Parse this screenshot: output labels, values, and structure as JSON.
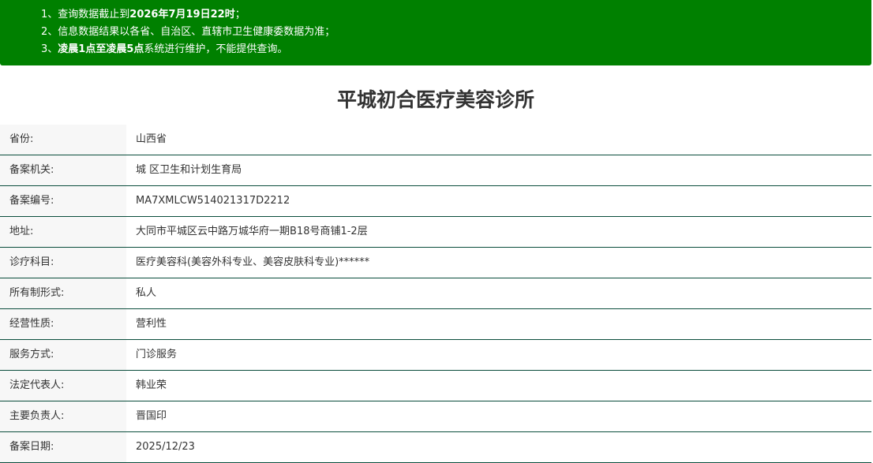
{
  "notice": {
    "line1_prefix": "1、查询数据截止到",
    "line1_bold": "2026年7月19日22时",
    "line1_suffix": "；",
    "line2": "2、信息数据结果以各省、自治区、直辖市卫生健康委数据为准；",
    "line3_prefix": "3、",
    "line3_bold": "凌晨1点至凌晨5点",
    "line3_suffix": "系统进行维护，不能提供查询。"
  },
  "title": "平城初合医疗美容诊所",
  "rows": [
    {
      "label": "省份:",
      "value": "山西省"
    },
    {
      "label": "备案机关:",
      "value": "城 区卫生和计划生育局"
    },
    {
      "label": "备案编号:",
      "value": "MA7XMLCW514021317D2212"
    },
    {
      "label": "地址:",
      "value": "大同市平城区云中路万城华府一期B18号商铺1-2层"
    },
    {
      "label": "诊疗科目:",
      "value": "医疗美容科(美容外科专业、美容皮肤科专业)******"
    },
    {
      "label": "所有制形式:",
      "value": "私人"
    },
    {
      "label": "经营性质:",
      "value": "营利性"
    },
    {
      "label": "服务方式:",
      "value": "门诊服务"
    },
    {
      "label": "法定代表人:",
      "value": "韩业荣"
    },
    {
      "label": "主要负责人:",
      "value": "晋国印"
    },
    {
      "label": "备案日期:",
      "value": "2025/12/23"
    }
  ],
  "colors": {
    "notice_background": "#008000",
    "row_divider": "#0a4d3c",
    "label_background": "#f7f7f7"
  }
}
